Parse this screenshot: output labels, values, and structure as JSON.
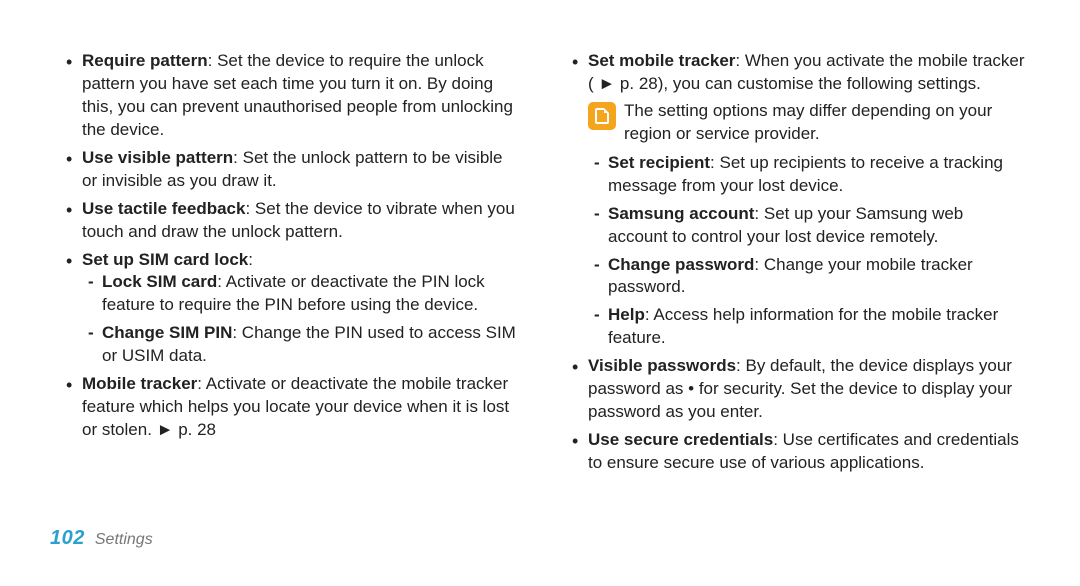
{
  "left": {
    "items": [
      {
        "label": "Require pattern",
        "text": ": Set the device to require the unlock pattern you have set each time you turn it on. By doing this, you can prevent unauthorised people from unlocking the device."
      },
      {
        "label": "Use visible pattern",
        "text": ": Set the unlock pattern to be visible or invisible as you draw it."
      },
      {
        "label": "Use tactile feedback",
        "text": ": Set the device to vibrate when you touch and draw the unlock pattern."
      },
      {
        "label": "Set up SIM card lock",
        "text": ":",
        "sub": [
          {
            "label": "Lock SIM card",
            "text": ": Activate or deactivate the PIN lock feature to require the PIN before using the device."
          },
          {
            "label": "Change SIM PIN",
            "text": ": Change the PIN used to access SIM or USIM data."
          }
        ]
      },
      {
        "label": "Mobile tracker",
        "text": ": Activate or deactivate the mobile tracker feature which helps you locate your device when it is lost or stolen. ► p. 28"
      }
    ]
  },
  "right": {
    "items": [
      {
        "label": "Set mobile tracker",
        "text": ": When you activate the mobile tracker ( ► p. 28), you can customise the following settings.",
        "note": "The setting options may differ depending on your region or service provider.",
        "sub": [
          {
            "label": "Set recipient",
            "text": ": Set up recipients to receive a tracking message from your lost device."
          },
          {
            "label": "Samsung account",
            "text": ": Set up your Samsung web account to control your lost device remotely."
          },
          {
            "label": "Change password",
            "text": ": Change your mobile tracker password."
          },
          {
            "label": "Help",
            "text": ": Access help information for the mobile tracker feature."
          }
        ]
      },
      {
        "label": "Visible passwords",
        "text": ": By default, the device displays your password as • for security. Set the device to display your password as you enter."
      },
      {
        "label": "Use secure credentials",
        "text": ": Use certificates and credentials to ensure secure use of various applications."
      }
    ]
  },
  "footer": {
    "page": "102",
    "section": "Settings"
  }
}
